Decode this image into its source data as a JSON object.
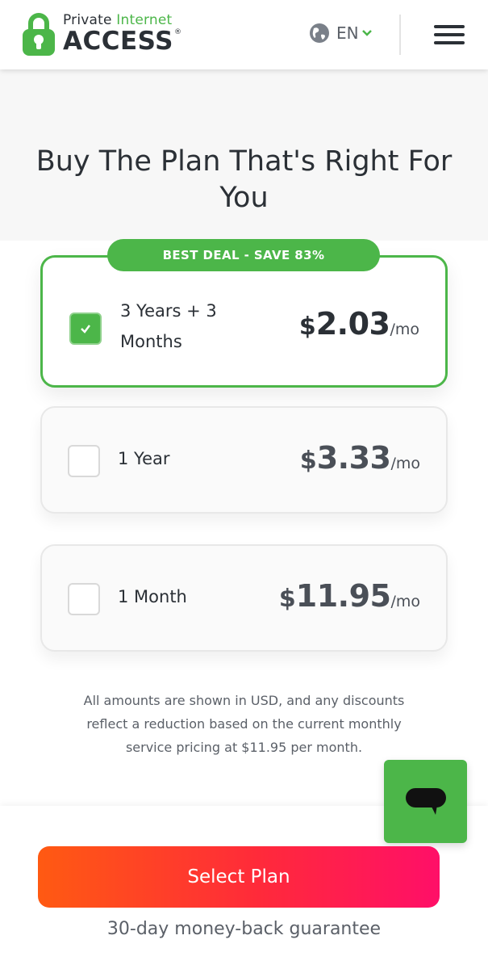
{
  "header": {
    "logo_line1_part1": "Private ",
    "logo_line1_part2": "Internet",
    "logo_line2": "ACCESS",
    "logo_reg": "®",
    "language": "EN",
    "icons": {
      "logo": "padlock-logo-icon",
      "globe": "globe-icon",
      "chevron": "chevron-down-icon",
      "menu": "hamburger-menu-icon"
    }
  },
  "title": "Buy The Plan That's Right For You",
  "plans": [
    {
      "badge": "BEST DEAL - SAVE 83%",
      "name": "3 Years + 3 Months",
      "currency": "$",
      "amount": "2.03",
      "per": "/mo",
      "selected": true
    },
    {
      "name": "1 Year",
      "currency": "$",
      "amount": "3.33",
      "per": "/mo",
      "selected": false
    },
    {
      "name": "1 Month",
      "currency": "$",
      "amount": "11.95",
      "per": "/mo",
      "selected": false
    }
  ],
  "disclaimer": "All amounts are shown in USD, and any discounts reflect a reduction based on the current monthly service pricing at $11.95 per month.",
  "chat": {
    "icon": "chat-bubble-icon"
  },
  "cta": {
    "label": "Select Plan",
    "guarantee": "30-day money-back guarantee"
  },
  "colors": {
    "brand_green": "#4cb649",
    "text_dark": "#2b3036",
    "gradient_start": "#ff5a12",
    "gradient_end": "#ff0f68"
  }
}
